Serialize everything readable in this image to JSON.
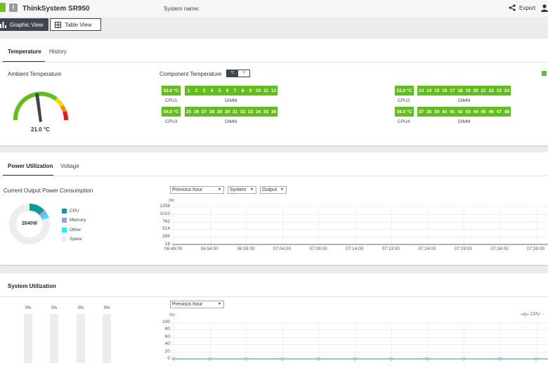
{
  "header": {
    "product_title": "ThinkSystem SR950",
    "system_name_label": "System name:",
    "export_label": "Export",
    "warn_glyph": "!"
  },
  "views": {
    "graphic": "Graphic View",
    "table": "Table View"
  },
  "temperature_panel": {
    "tabs": [
      "Temperature",
      "History"
    ],
    "ambient_title": "Ambient Temperature",
    "ambient_value": "21.0 °C",
    "component_title": "Component Temperature",
    "unit_toggle": [
      "°C",
      "°F"
    ],
    "groups": [
      {
        "cpu_temp": "53.0 °C",
        "cpu_label": "CPU1",
        "dimm_label": "DIMM",
        "dimms": [
          "1",
          "2",
          "3",
          "4",
          "5",
          "6",
          "7",
          "8",
          "9",
          "10",
          "11",
          "12"
        ]
      },
      {
        "cpu_temp": "54.0 °C",
        "cpu_label": "CPU3",
        "dimm_label": "DIMM",
        "dimms": [
          "25",
          "26",
          "27",
          "28",
          "29",
          "30",
          "31",
          "32",
          "33",
          "34",
          "35",
          "36"
        ]
      },
      {
        "cpu_temp": "53.0 °C",
        "cpu_label": "CPU2",
        "dimm_label": "DIMM",
        "dimms": [
          "13",
          "14",
          "15",
          "16",
          "17",
          "18",
          "19",
          "20",
          "21",
          "22",
          "23",
          "24"
        ]
      },
      {
        "cpu_temp": "58.0 °C",
        "cpu_label": "CPU4",
        "dimm_label": "DIMM",
        "dimms": [
          "37",
          "38",
          "39",
          "40",
          "41",
          "42",
          "43",
          "44",
          "45",
          "46",
          "47",
          "48"
        ]
      }
    ]
  },
  "power_panel": {
    "tabs": [
      "Power Utilization",
      "Voltage"
    ],
    "title": "Current Output Power Consumption",
    "donut_center": "2640W",
    "legend": [
      {
        "label": "CPU",
        "color": "#109a94"
      },
      {
        "label": "Memory",
        "color": "#9b9de8"
      },
      {
        "label": "Other",
        "color": "#31e7f0"
      },
      {
        "label": "Spare",
        "color": "#ededed"
      }
    ],
    "selects": [
      "Previous hour",
      "System",
      "Output"
    ],
    "unit": "(W)"
  },
  "system_panel": {
    "title": "System Utilization",
    "select": "Previous hour",
    "bar_pcts": [
      "0%",
      "0%",
      "0%",
      "0%"
    ],
    "unit": "(%)",
    "legend_cpu": "CPU"
  },
  "chart_data": [
    {
      "type": "pie",
      "title": "",
      "labels": [
        "CPU",
        "Memory",
        "Other",
        "Spare"
      ],
      "values": [
        13,
        4,
        3,
        80
      ]
    },
    {
      "type": "line",
      "title": "",
      "ylabel": "(W)",
      "y_ticks": [
        "1258",
        "1010",
        "762",
        "514",
        "266",
        "18"
      ],
      "ylim": [
        18,
        1258
      ],
      "x": [
        "06:49:00",
        "06:54:00",
        "06:59:00",
        "07:04:00",
        "07:09:00",
        "07:14:00",
        "07:19:00",
        "07:24:00",
        "07:29:00",
        "07:34:00",
        "07:39:00"
      ],
      "series": [
        {
          "values": [
            18,
            18,
            18,
            18,
            18,
            18,
            18,
            18,
            18,
            18,
            18
          ]
        }
      ],
      "grid": true
    },
    {
      "type": "line",
      "title": "",
      "ylabel": "(%)",
      "y_ticks": [
        "100",
        "80",
        "60",
        "40",
        "20",
        "0"
      ],
      "ylim": [
        0,
        100
      ],
      "series": [
        {
          "name": "CPU",
          "values": [
            0,
            0,
            0,
            0,
            0,
            0,
            0,
            0,
            0,
            0,
            0
          ]
        }
      ],
      "grid": true
    }
  ]
}
